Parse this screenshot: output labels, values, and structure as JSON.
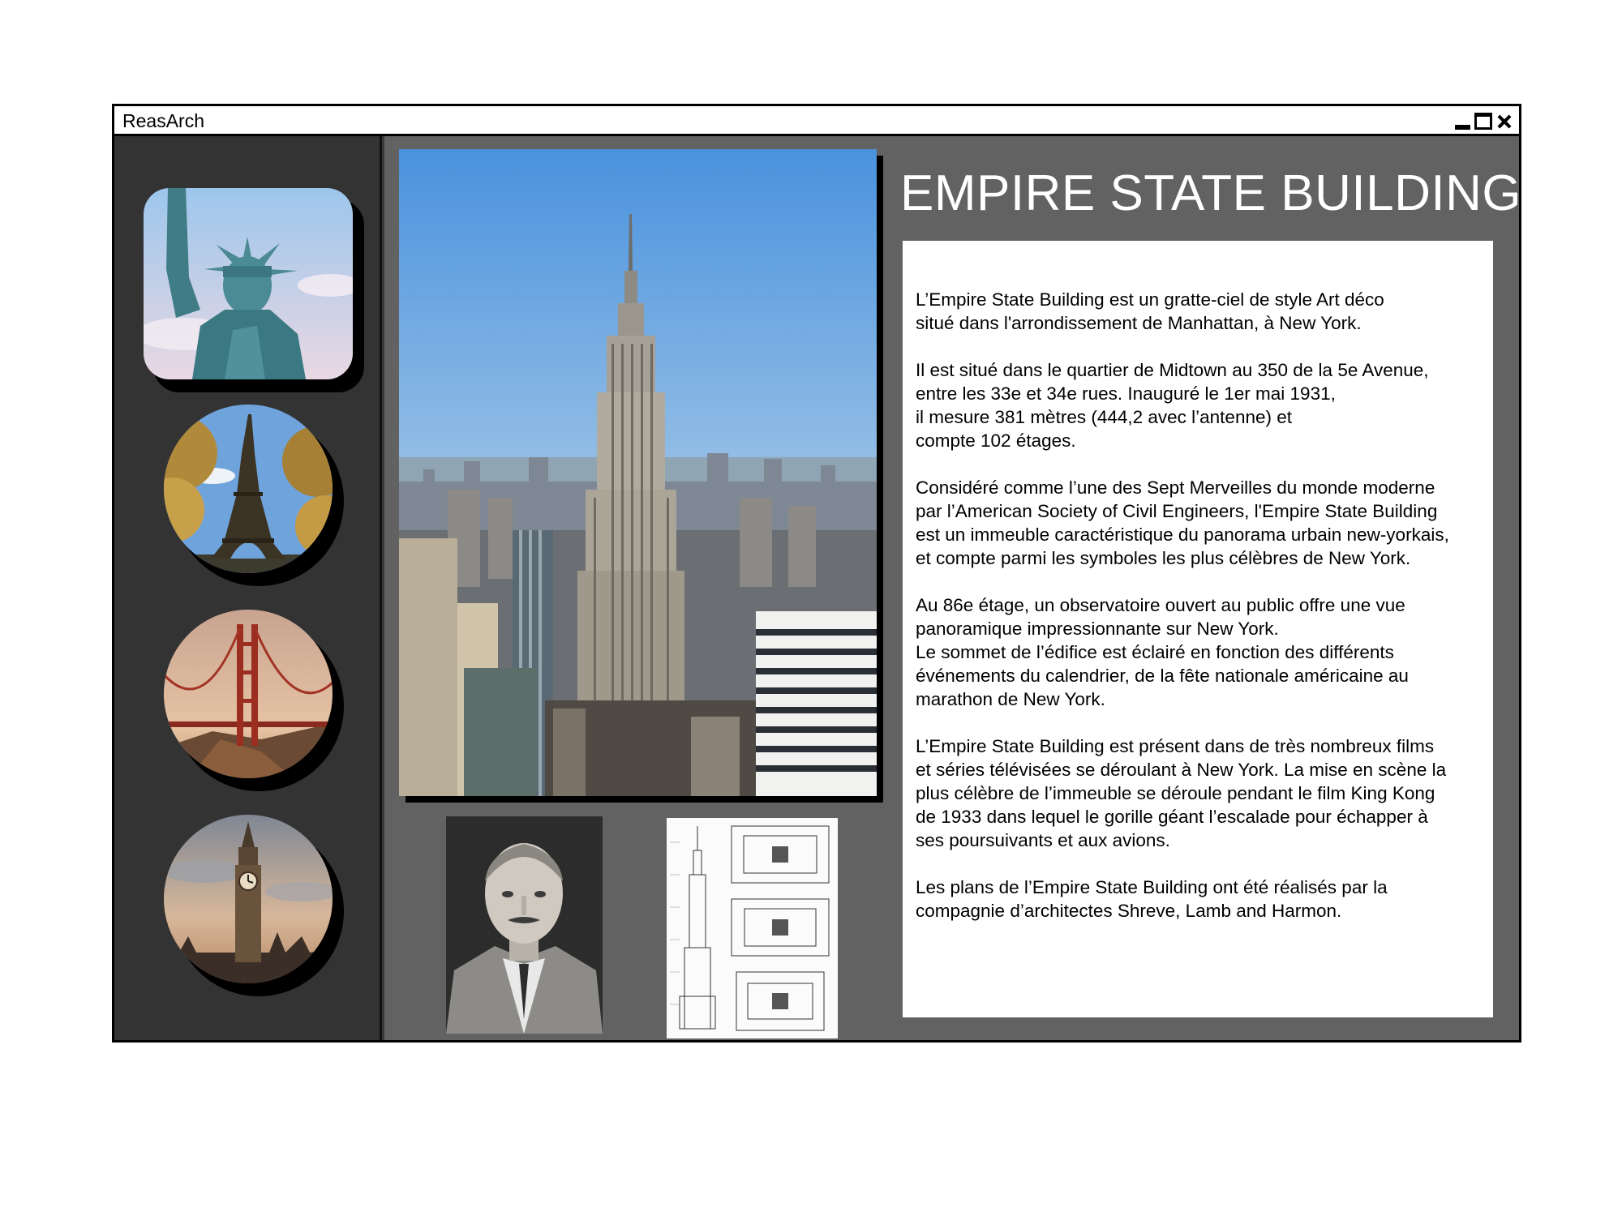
{
  "window": {
    "title": "ReasArch"
  },
  "sidebar": {
    "items": [
      {
        "name": "Statue of Liberty",
        "shape": "rounded"
      },
      {
        "name": "Eiffel Tower",
        "shape": "circle"
      },
      {
        "name": "Golden Gate Bridge",
        "shape": "circle"
      },
      {
        "name": "Big Ben",
        "shape": "circle"
      }
    ]
  },
  "article": {
    "heading": "EMPIRE STATE BUILDING",
    "paragraphs": [
      "L’Empire State Building est un gratte-ciel de style Art déco\nsitué dans l'arrondissement de Manhattan, à New York.",
      "Il est situé dans le quartier de Midtown au 350 de la 5e Avenue,\nentre les 33e et 34e rues. Inauguré le 1er mai 1931,\nil mesure 381 mètres (444,2 avec l’antenne) et\ncompte 102 étages.",
      "Considéré comme l’une des Sept Merveilles du monde moderne\npar l’American Society of Civil Engineers, l'Empire State Building\nest un immeuble caractéristique du panorama urbain new-yorkais,\net compte parmi les symboles les plus célèbres de New York.",
      "Au 86e étage, un observatoire ouvert au public offre une vue\npanoramique impressionnante sur New York.\nLe sommet de l’édifice est éclairé en fonction des différents\névénements du calendrier, de la fête nationale américaine au\nmarathon de New York.",
      "L’Empire State Building est présent dans de très nombreux films\net séries télévisées se déroulant à New York. La mise en scène la\nplus célèbre de l’immeuble se déroule pendant le film King Kong\nde 1933 dans lequel le gorille géant l’escalade pour échapper à\nses poursuivants et aux avions.",
      "Les plans de l’Empire State Building ont été réalisés par la\ncompagnie d’architectes Shreve, Lamb and Harmon."
    ]
  },
  "colors": {
    "sidebar_bg": "#333333",
    "main_bg": "#626262",
    "sky": "#5ea3e0"
  }
}
